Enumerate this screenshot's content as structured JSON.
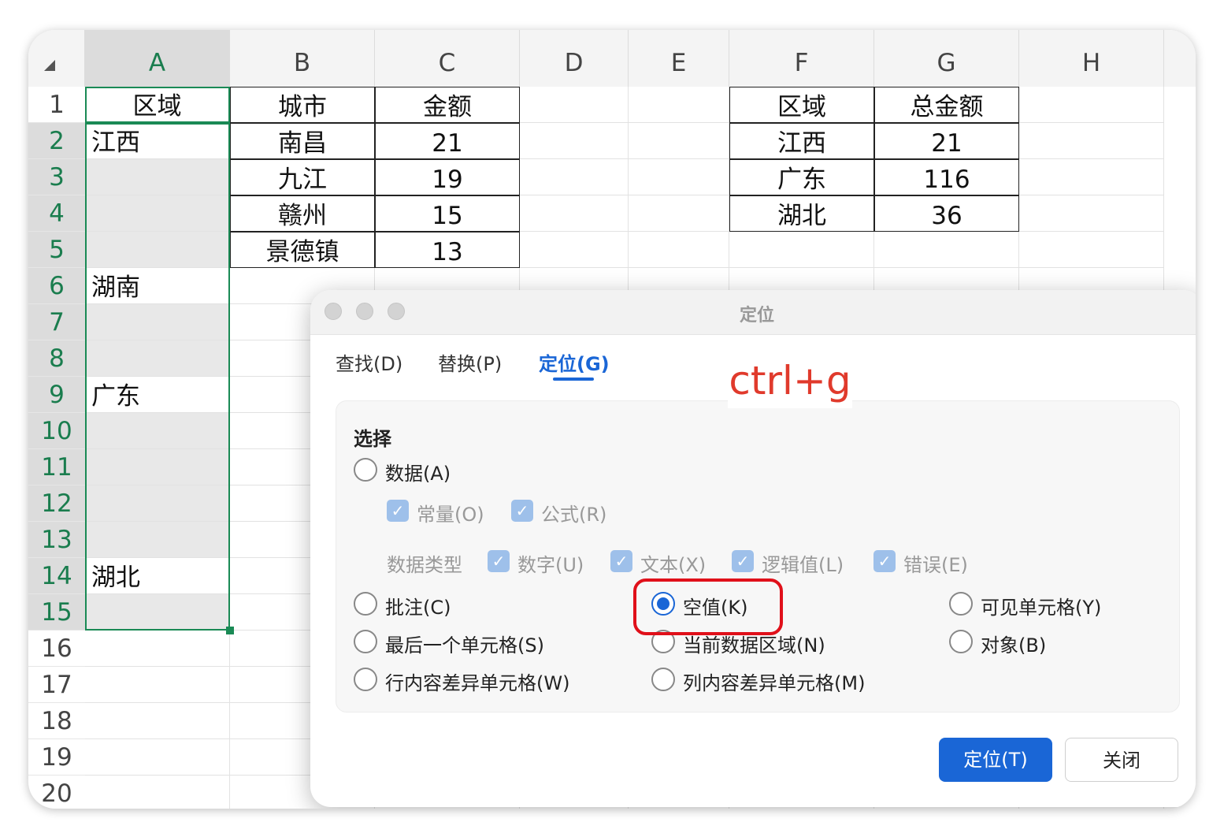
{
  "sheet": {
    "columns": [
      "A",
      "B",
      "C",
      "D",
      "E",
      "F",
      "G",
      "H"
    ],
    "rows": [
      "1",
      "2",
      "3",
      "4",
      "5",
      "6",
      "7",
      "8",
      "9",
      "10",
      "11",
      "12",
      "13",
      "14",
      "15",
      "16",
      "17",
      "18",
      "19",
      "20"
    ],
    "col_a": [
      "区域",
      "江西",
      "",
      "",
      "",
      "湖南",
      "",
      "",
      "广东",
      "",
      "",
      "",
      "",
      "湖北",
      ""
    ],
    "col_b": [
      "城市",
      "南昌",
      "九江",
      "赣州",
      "景德镇"
    ],
    "col_c": [
      "金额",
      "21",
      "19",
      "15",
      "13"
    ],
    "summary": {
      "headers": [
        "区域",
        "总金额"
      ],
      "rows": [
        [
          "江西",
          "21"
        ],
        [
          "广东",
          "116"
        ],
        [
          "湖北",
          "36"
        ]
      ]
    }
  },
  "dialog": {
    "title": "定位",
    "tabs": [
      "查找(D)",
      "替换(P)",
      "定位(G)"
    ],
    "active_tab": "定位(G)",
    "shortcut_note": "ctrl+g",
    "section_label": "选择",
    "options": {
      "data": "数据(A)",
      "constant": "常量(O)",
      "formula": "公式(R)",
      "data_type_label": "数据类型",
      "number": "数字(U)",
      "text": "文本(X)",
      "logical": "逻辑值(L)",
      "error": "错误(E)",
      "comment": "批注(C)",
      "blank": "空值(K)",
      "visible": "可见单元格(Y)",
      "last_cell": "最后一个单元格(S)",
      "current_region": "当前数据区域(N)",
      "object": "对象(B)",
      "row_diff": "行内容差异单元格(W)",
      "col_diff": "列内容差异单元格(M)"
    },
    "selected_option": "空值(K)",
    "buttons": {
      "go": "定位(T)",
      "close": "关闭"
    }
  },
  "colors": {
    "accent": "#1a66d6",
    "selection": "#1a8a55",
    "highlight": "#e0101a"
  }
}
